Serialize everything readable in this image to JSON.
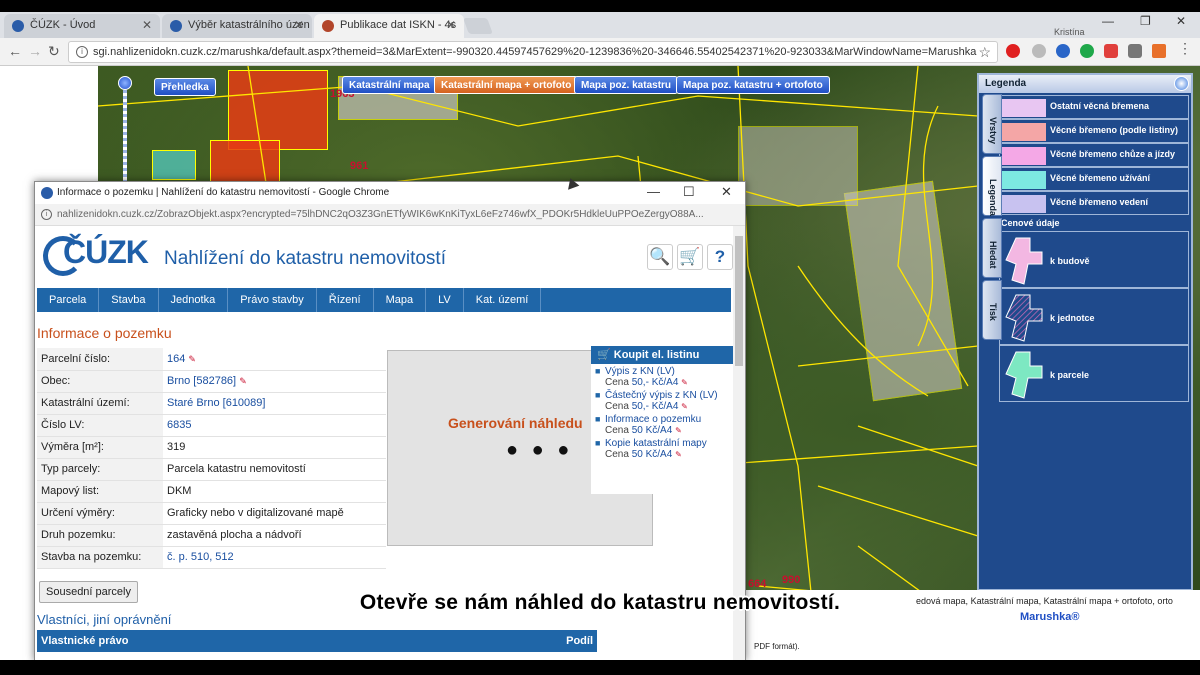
{
  "browser": {
    "tabs": [
      {
        "title": "ČÚZK - Úvod"
      },
      {
        "title": "Výběr katastrálního úzen"
      },
      {
        "title": "Publikace dat ISKN - 4s"
      }
    ],
    "user": "Kristína",
    "url": "sgi.nahlizenidokn.cuzk.cz/marushka/default.aspx?themeid=3&MarExtent=-990320.44597457629%20-1239836%20-346646.55402542371%20-923033&MarWindowName=Marushka"
  },
  "map": {
    "buttons": {
      "prehledka": "Přehledka",
      "katastralni": "Katastrální mapa",
      "katastralni_orto": "Katastrální mapa + ortofoto",
      "mapa_poz": "Mapa poz. katastru",
      "mapa_poz_orto": "Mapa poz. katastru + ortofoto"
    },
    "labels": [
      "1963",
      "961",
      "664",
      "990"
    ],
    "footer_text": "Katastrální mapa, Katastrální mapa + ortofoto, orto",
    "footer_prefix": "edová mapa,",
    "brand": "Marushka®",
    "pdf_note": "PDF formát)."
  },
  "legend": {
    "title": "Legenda",
    "vtabs": [
      "Vrstvy",
      "Legenda",
      "Hledat",
      "Tisk"
    ],
    "items": [
      {
        "label": "Ostatní věcná břemena",
        "color": "#e8c6f2"
      },
      {
        "label": "Věcné břemeno (podle listiny)",
        "color": "#f4a6a6"
      },
      {
        "label": "Věcné břemeno chůze a jízdy",
        "color": "#f4a8e6"
      },
      {
        "label": "Věcné břemeno užívání",
        "color": "#7de8e2"
      },
      {
        "label": "Věcné břemeno vedení",
        "color": "#c8c2f0"
      }
    ],
    "section": "Cenové údaje",
    "price_items": [
      {
        "label": "k budově",
        "color": "#f3b7e2"
      },
      {
        "label": "k jednotce",
        "color": "#f3c6ea"
      },
      {
        "label": "k parcele",
        "color": "#7de8c2"
      }
    ]
  },
  "popup": {
    "window_title": "Informace o pozemku | Nahlížení do katastru nemovitostí - Google Chrome",
    "url": "nahlizenidokn.cuzk.cz/ZobrazObjekt.aspx?encrypted=75lhDNC2qO3Z3GnETfyWIK6wKnKiTyxL6eFz746wfX_PDOKr5HdkleUuPPOeZergyO88A...",
    "logo": "ČÚZK",
    "app_name": "Nahlížení do katastru nemovitostí",
    "nav": [
      "Parcela",
      "Stavba",
      "Jednotka",
      "Právo stavby",
      "Řízení",
      "Mapa",
      "LV",
      "Kat. území"
    ],
    "section_title": "Informace o pozemku",
    "rows": [
      {
        "label": "Parcelní číslo:",
        "value": "164",
        "link": true
      },
      {
        "label": "Obec:",
        "value": "Brno [582786]",
        "link": true
      },
      {
        "label": "Katastrální území:",
        "value": "Staré Brno [610089]",
        "link": true
      },
      {
        "label": "Číslo LV:",
        "value": "6835",
        "link": true
      },
      {
        "label": "Výměra [m²]:",
        "value": "319",
        "link": false
      },
      {
        "label": "Typ parcely:",
        "value": "Parcela katastru nemovitostí",
        "link": false
      },
      {
        "label": "Mapový list:",
        "value": "DKM",
        "link": false
      },
      {
        "label": "Určení výměry:",
        "value": "Graficky nebo v digitalizované mapě",
        "link": false
      },
      {
        "label": "Druh pozemku:",
        "value": "zastavěná plocha a nádvoří",
        "link": false
      },
      {
        "label": "Stavba na pozemku:",
        "value": "č. p. 510, 512",
        "link": true
      }
    ],
    "preview_text": "Generování náhledu",
    "preview_dots": "● ● ●",
    "buy": {
      "title": "Koupit el. listinu",
      "items": [
        {
          "name": "Výpis z KN (LV)",
          "price_label": "Cena",
          "price": "50,- Kč/A4"
        },
        {
          "name": "Částečný výpis z KN (LV)",
          "price_label": "Cena",
          "price": "50,- Kč/A4"
        },
        {
          "name": "Informace o pozemku",
          "price_label": "Cena",
          "price": "50 Kč/A4"
        },
        {
          "name": "Kopie katastrální mapy",
          "price_label": "Cena",
          "price": "50 Kč/A4"
        }
      ]
    },
    "neighbors_button": "Sousední parcely",
    "owners_title": "Vlastníci, jiní oprávnění",
    "owners_header": "Vlastnické právo",
    "owners_header_right": "Podíl"
  },
  "subtitle": "Otevře se nám náhled do katastru nemovitostí."
}
